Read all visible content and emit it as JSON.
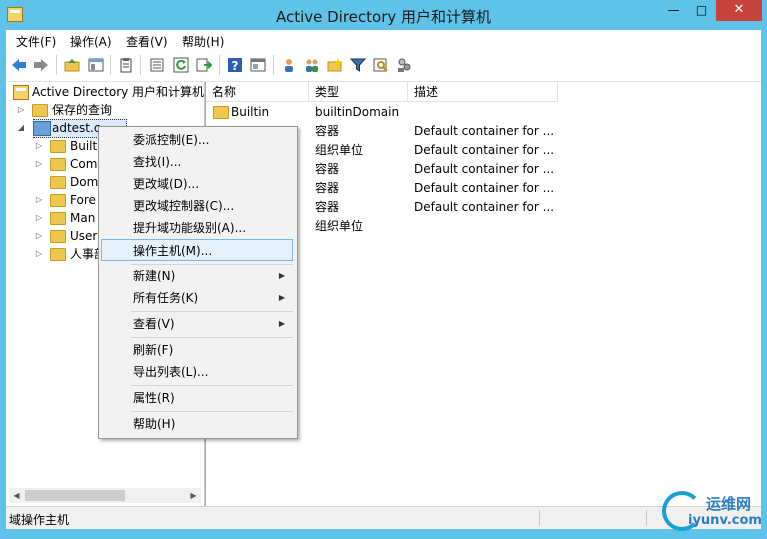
{
  "window": {
    "title": "Active Directory 用户和计算机",
    "minimize": "—",
    "maximize": "□",
    "close": "✕"
  },
  "menubar": [
    "文件(F)",
    "操作(A)",
    "查看(V)",
    "帮助(H)"
  ],
  "toolbar_icons": [
    "back-icon",
    "forward-icon",
    "up-folder-icon",
    "show-tree-icon",
    "clipboard-icon",
    "export-list-icon",
    "refresh-icon",
    "export-icon",
    "help-icon",
    "properties-icon",
    "users-icon",
    "groups-icon",
    "new-folder-icon",
    "filter-icon",
    "find-icon",
    "delegate-icon"
  ],
  "tree": {
    "root": "Active Directory 用户和计算机",
    "saved_queries": "保存的查询",
    "domain": "adtest.c",
    "children": [
      "Builti",
      "Com",
      "Dom",
      "Fore",
      "Man",
      "User",
      "人事部"
    ]
  },
  "list": {
    "columns": [
      "名称",
      "类型",
      "描述"
    ],
    "rows": [
      {
        "name": "Builtin",
        "type": "builtinDomain",
        "desc": ""
      },
      {
        "name": "",
        "type": "容器",
        "desc": "Default container for ..."
      },
      {
        "name": "",
        "type": "组织单位",
        "desc": "Default container for ..."
      },
      {
        "name": "",
        "type": "容器",
        "desc": "Default container for ..."
      },
      {
        "name": "",
        "type": "容器",
        "desc": "Default container for ..."
      },
      {
        "name": "",
        "type": "容器",
        "desc": "Default container for ..."
      },
      {
        "name": "",
        "type": "组织单位",
        "desc": ""
      }
    ]
  },
  "context_menu": {
    "items": [
      "委派控制(E)...",
      "查找(I)...",
      "更改域(D)...",
      "更改域控制器(C)...",
      "提升域功能级别(A)...",
      "操作主机(M)...",
      "新建(N)",
      "所有任务(K)",
      "查看(V)",
      "刷新(F)",
      "导出列表(L)...",
      "属性(R)",
      "帮助(H)"
    ],
    "highlighted": "操作主机(M)..."
  },
  "status": "域操作主机",
  "watermark": {
    "top": "运维网",
    "bottom": "iyunv.com"
  }
}
